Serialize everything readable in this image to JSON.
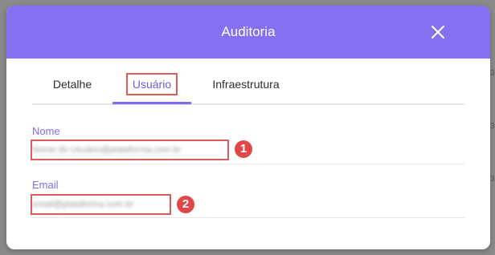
{
  "modal": {
    "title": "Auditoria",
    "close_icon": "close-icon"
  },
  "tabs": [
    {
      "label": "Detalhe",
      "active": false
    },
    {
      "label": "Usuário",
      "active": true
    },
    {
      "label": "Infraestrutura",
      "active": false
    }
  ],
  "fields": {
    "nome": {
      "label": "Nome",
      "value": "Nome do Usuário@plataforma.com.br"
    },
    "email": {
      "label": "Email",
      "value": "email@plataforma.com.br"
    }
  },
  "annotations": {
    "marker_1": "1",
    "marker_2": "2"
  },
  "colors": {
    "header": "#8470f0",
    "accent": "#7c6cf0",
    "annotation": "#e05a5a"
  }
}
